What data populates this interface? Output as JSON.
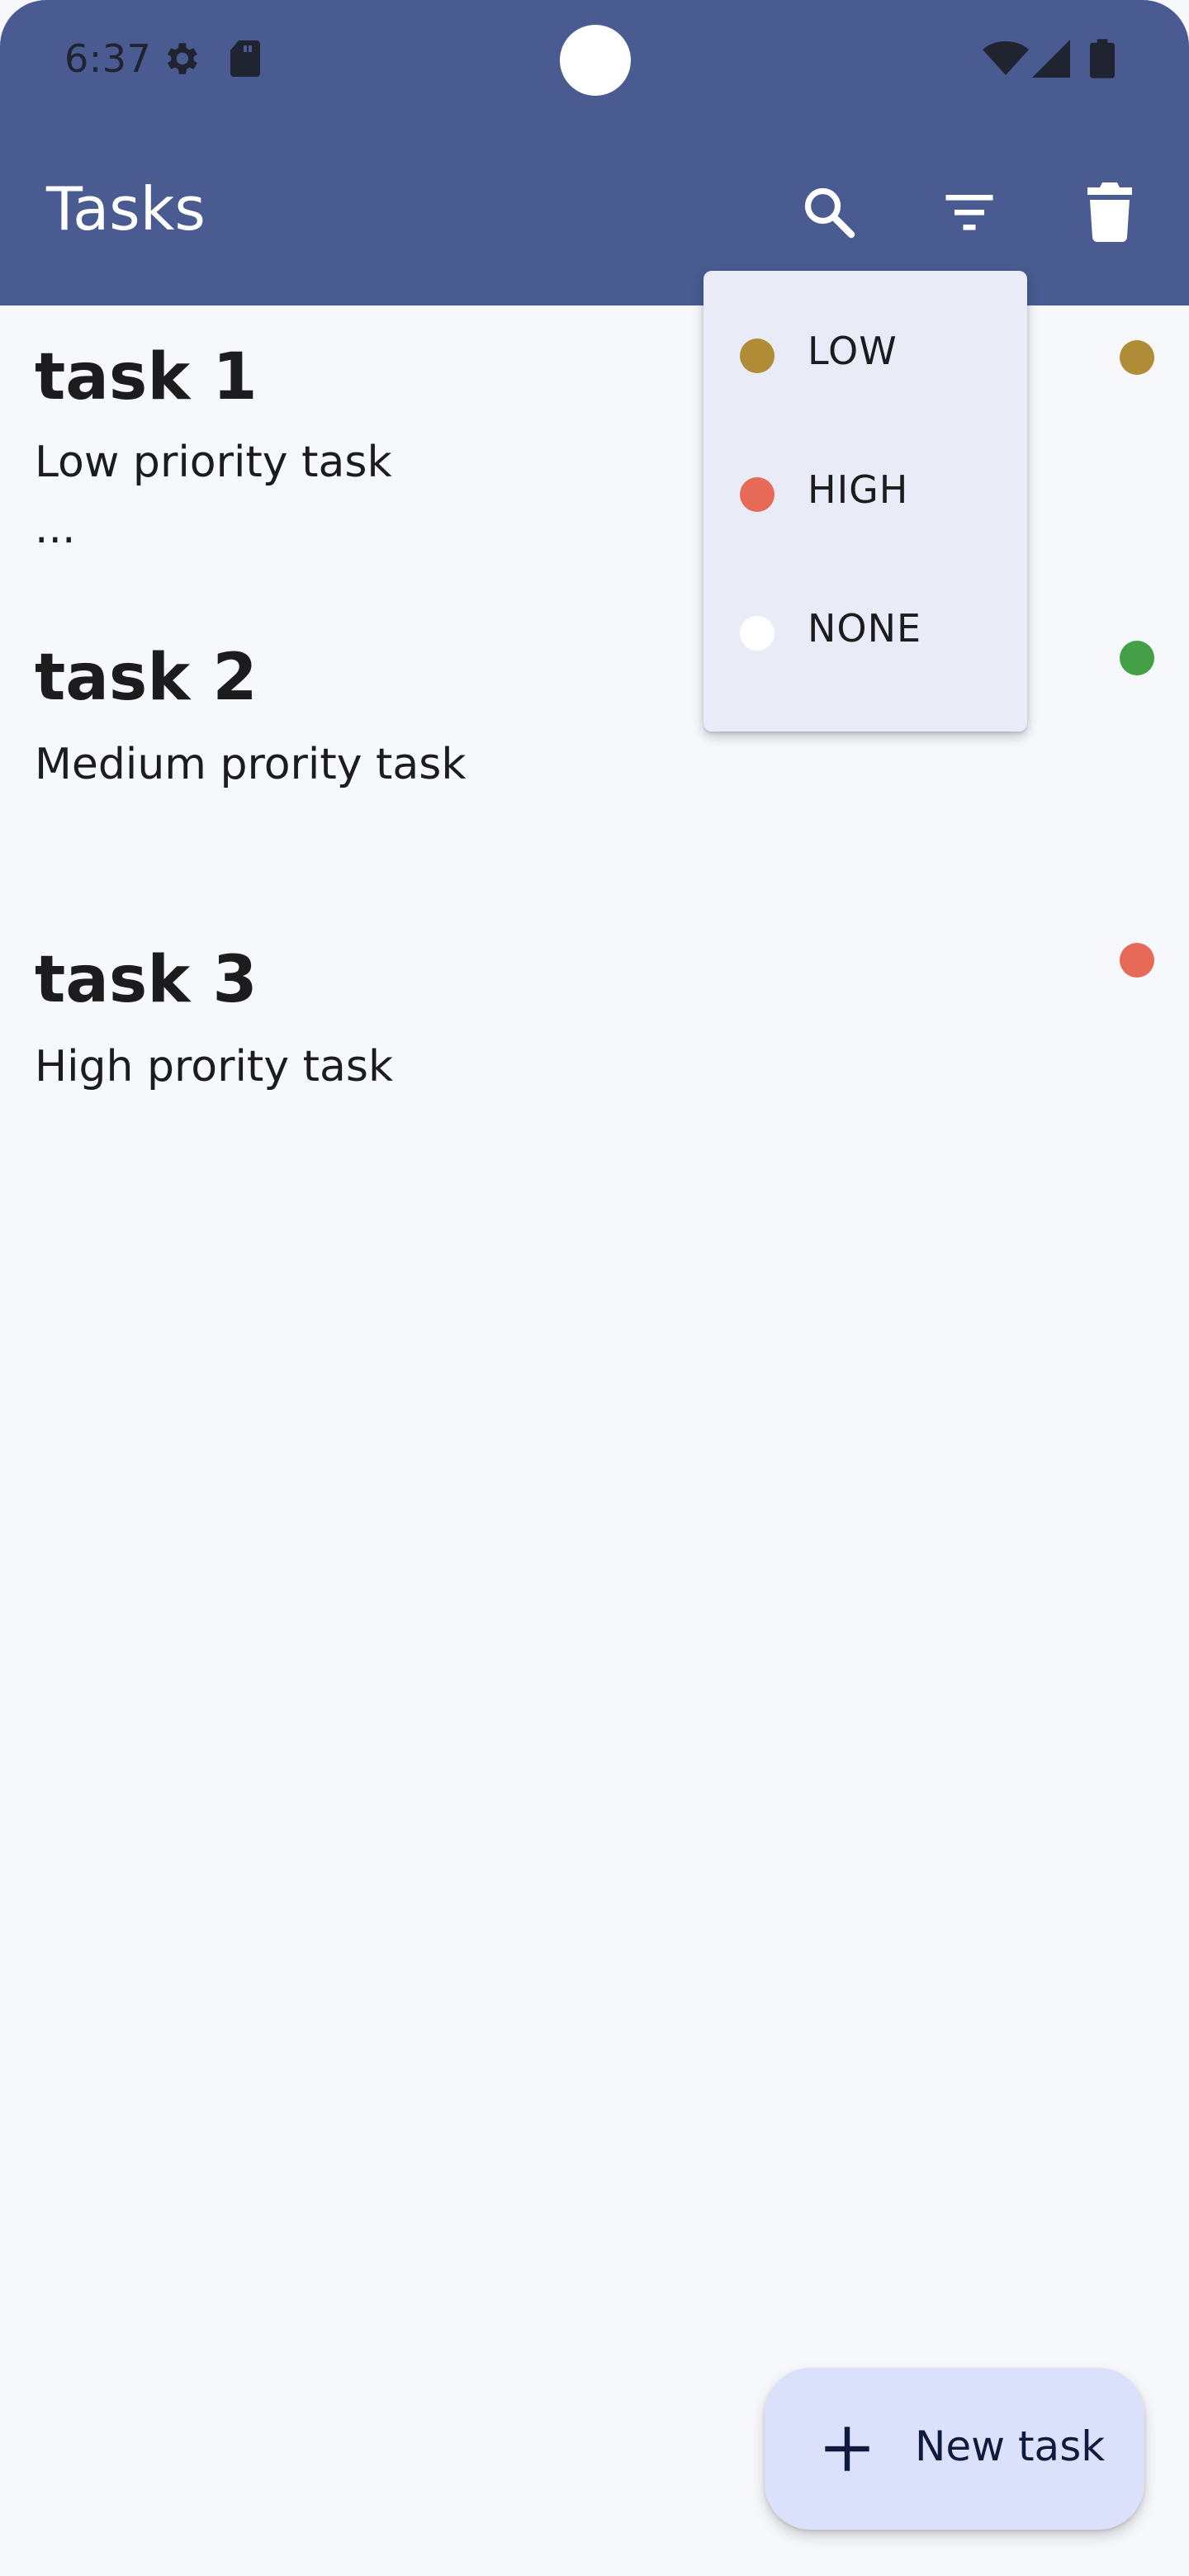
{
  "status_bar": {
    "time": "6:37",
    "left_icons": [
      "settings-icon",
      "sd-card-icon"
    ],
    "right_icons": [
      "wifi-icon",
      "cellular-signal-icon",
      "battery-icon"
    ]
  },
  "app_bar": {
    "title": "Tasks",
    "actions": [
      "search-icon",
      "filter-icon",
      "delete-icon"
    ],
    "background_color": "#4a5b91"
  },
  "tasks": [
    {
      "title": "task 1",
      "description": "Low priority task",
      "extra": "...",
      "priority_color": "#b08c36"
    },
    {
      "title": "task 2",
      "description": "Medium prority task",
      "priority_color": "#43a047"
    },
    {
      "title": "task 3",
      "description": "High prority task",
      "priority_color": "#e76a57"
    }
  ],
  "filter_menu": {
    "items": [
      {
        "label": "LOW",
        "color": "#b08c36"
      },
      {
        "label": "HIGH",
        "color": "#e76a57"
      },
      {
        "label": "NONE",
        "color": "#ffffff"
      }
    ]
  },
  "fab": {
    "icon": "add-icon",
    "label": "New task"
  }
}
